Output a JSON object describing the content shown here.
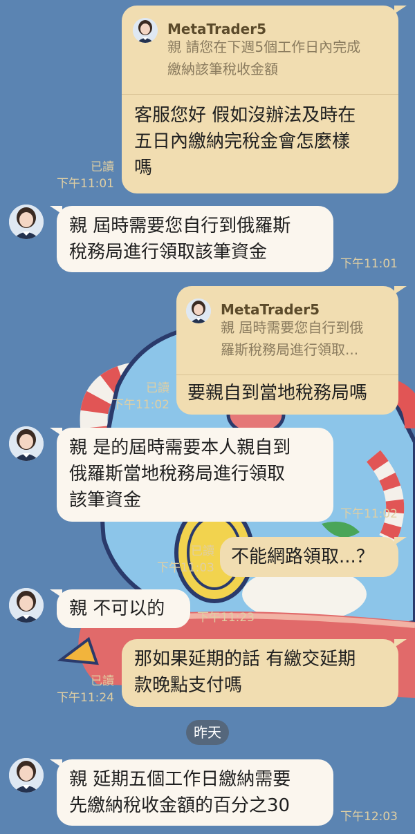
{
  "contact_name": "MetaTrader5",
  "date_separator": "昨天",
  "messages": [
    {
      "direction": "out",
      "quote_name": "MetaTrader5",
      "quote_text": "親 請您在下週5個工作日內完成\n繳納該筆稅收金額",
      "text": "客服您好  假如沒辦法及時在\n五日內繳納完稅金會怎麼樣\n嗎",
      "read": "已讀",
      "time": "下午11:01"
    },
    {
      "direction": "in",
      "text": "親 屆時需要您自行到俄羅斯\n稅務局進行領取該筆資金",
      "time": "下午11:01"
    },
    {
      "direction": "out",
      "quote_name": "MetaTrader5",
      "quote_text": "親 屆時需要您自行到俄\n羅斯稅務局進行領取...",
      "text": "要親自到當地稅務局嗎",
      "read": "已讀",
      "time": "下午11:02"
    },
    {
      "direction": "in",
      "text": "親 是的屆時需要本人親自到\n俄羅斯當地稅務局進行領取\n該筆資金",
      "time": "下午11:02"
    },
    {
      "direction": "out",
      "text": "不能網路領取...？",
      "read": "已讀",
      "time": "下午11:03"
    },
    {
      "direction": "in",
      "text": "親 不可以的",
      "time": "下午11:23"
    },
    {
      "direction": "out",
      "text": "那如果延期的話 有繳交延期\n款晚點支付嗎",
      "read": "已讀",
      "time": "下午11:24"
    },
    {
      "direction": "in",
      "text": "親 延期五個工作日繳納需要\n先繳納稅收金額的百分之30",
      "time": "下午12:03"
    }
  ]
}
